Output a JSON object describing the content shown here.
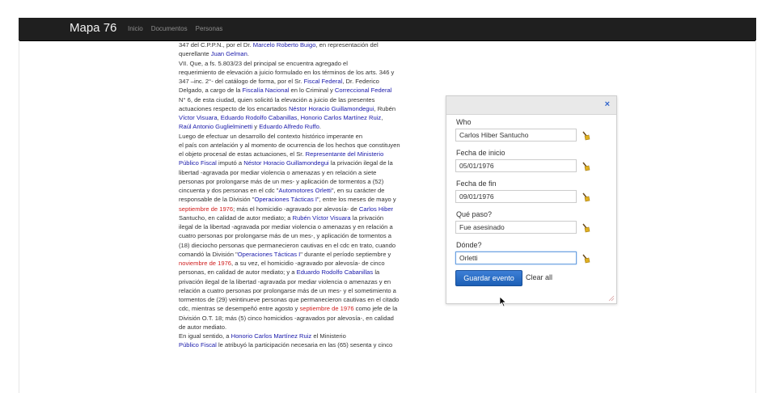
{
  "header": {
    "brand": "Mapa 76",
    "nav": [
      "Inicio",
      "Documentos",
      "Personas"
    ]
  },
  "article": {
    "lines": [
      [
        {
          "t": "347 del C.P.P.N., por el Dr. "
        },
        {
          "t": "Marcelo Roberto Buigo",
          "c": "lk"
        },
        {
          "t": ", en representación del"
        }
      ],
      [
        {
          "t": "querellante "
        },
        {
          "t": "Juan Gelman",
          "c": "lk"
        },
        {
          "t": "."
        }
      ],
      [
        {
          "t": "VII. Que, a fs. 5.803/23 del principal se encuentra agregado el"
        }
      ],
      [
        {
          "t": "requerimiento de elevación a juicio formulado en los términos de los arts. 346 y"
        }
      ],
      [
        {
          "t": "347 –inc. 2°- del catálogo de forma, por el Sr. "
        },
        {
          "t": "Fiscal Federal",
          "c": "lk"
        },
        {
          "t": ", Dr. Federico"
        }
      ],
      [
        {
          "t": "Delgado, a cargo de la "
        },
        {
          "t": "Fiscalía Nacional",
          "c": "lk"
        },
        {
          "t": " en lo Criminal y "
        },
        {
          "t": "Correccional Federal",
          "c": "lk"
        }
      ],
      [
        {
          "t": "N° 6, de esta ciudad, quien solicitó la elevación a juicio de las presentes"
        }
      ],
      [
        {
          "t": "actuaciones respecto de los encartados "
        },
        {
          "t": "Néstor Horacio Guillamondegui",
          "c": "lk"
        },
        {
          "t": ", Rubén"
        }
      ],
      [
        {
          "t": "Víctor Visuara",
          "c": "lk"
        },
        {
          "t": ", "
        },
        {
          "t": "Eduardo Rodolfo Cabanillas",
          "c": "lk"
        },
        {
          "t": ", "
        },
        {
          "t": "Honorio Carlos Martínez Ruiz",
          "c": "lk"
        },
        {
          "t": ","
        }
      ],
      [
        {
          "t": "Raúl Antonio Guglielminetti",
          "c": "lk"
        },
        {
          "t": " y "
        },
        {
          "t": "Eduardo Alfredo Ruffo",
          "c": "lk"
        },
        {
          "t": "."
        }
      ],
      [
        {
          "t": "Luego de efectuar un desarrollo del contexto histórico imperante en"
        }
      ],
      [
        {
          "t": "el país con antelación y al momento de ocurrencia de los hechos que constituyen"
        }
      ],
      [
        {
          "t": "el objeto procesal de estas actuaciones, el Sr. "
        },
        {
          "t": "Representante del Ministerio",
          "c": "lk"
        }
      ],
      [
        {
          "t": "Público Fiscal",
          "c": "lk"
        },
        {
          "t": " imputó a "
        },
        {
          "t": "Néstor Horacio Guillamondegui",
          "c": "lk"
        },
        {
          "t": " la privación ilegal de la"
        }
      ],
      [
        {
          "t": "libertad -agravada por mediar violencia o amenazas y en relación a siete"
        }
      ],
      [
        {
          "t": "personas por prolongarse más de un mes- y aplicación de tormentos a (52)"
        }
      ],
      [
        {
          "t": "cincuenta y dos personas en el cdc \""
        },
        {
          "t": "Automotores Orletti",
          "c": "lk"
        },
        {
          "t": "\", en su carácter de"
        }
      ],
      [
        {
          "t": "responsable de la División \""
        },
        {
          "t": "Operaciones Tácticas I",
          "c": "lk"
        },
        {
          "t": "\", entre los meses de mayo y"
        }
      ],
      [
        {
          "t": "septiembre de 1976",
          "c": "rd"
        },
        {
          "t": "; más el homicidio -agravado por alevosía- de "
        },
        {
          "t": "Carlos Hiber",
          "c": "lk"
        }
      ],
      [
        {
          "t": "Santucho, en calidad de autor mediato; a "
        },
        {
          "t": "Rubén Víctor Visuara",
          "c": "lk"
        },
        {
          "t": " la privación"
        }
      ],
      [
        {
          "t": "ilegal de la libertad -agravada por mediar violencia o amenazas y en relación a"
        }
      ],
      [
        {
          "t": "cuatro personas por prolongarse más de un mes-, y aplicación de tormentos a"
        }
      ],
      [
        {
          "t": "(18) dieciocho personas que permanecieron cautivas en el cdc en trato, cuando"
        }
      ],
      [
        {
          "t": "comandó la División \""
        },
        {
          "t": "Operaciones Tácticas I",
          "c": "lk"
        },
        {
          "t": "\" durante el período septiembre y"
        }
      ],
      [
        {
          "t": "noviembre de 1976",
          "c": "rd"
        },
        {
          "t": ", a su vez, el homicidio -agravado por alevosía- de cinco"
        }
      ],
      [
        {
          "t": "personas, en calidad de autor mediato; y a "
        },
        {
          "t": "Eduardo Rodolfo Cabanillas",
          "c": "lk"
        },
        {
          "t": " la"
        }
      ],
      [
        {
          "t": "privación ilegal de la libertad -agravada por mediar violencia o amenazas y en"
        }
      ],
      [
        {
          "t": "relación a cuatro personas por prolongarse más de un mes- y el sometimiento a"
        }
      ],
      [
        {
          "t": "tormentos de (29) veintinueve personas que permanecieron cautivas en el citado"
        }
      ],
      [
        {
          "t": "cdc, mientras se desempeñó entre agosto y "
        },
        {
          "t": "septiembre de 1976",
          "c": "rd"
        },
        {
          "t": " como jefe de la"
        }
      ],
      [
        {
          "t": "División O.T. 18; más (5) cinco homicidios -agravados por alevosía-, en calidad"
        }
      ],
      [
        {
          "t": "de autor mediato."
        }
      ],
      [
        {
          "t": "En igual sentido, a "
        },
        {
          "t": "Honorio Carlos Martínez Ruiz",
          "c": "lk"
        },
        {
          "t": " el Ministerio"
        }
      ],
      [
        {
          "t": "Público Fiscal",
          "c": "lk"
        },
        {
          "t": " le atribuyó la participación necesaria en las (65) sesenta y cinco"
        }
      ]
    ]
  },
  "dialog": {
    "close_label": "×",
    "fields": [
      {
        "label": "Who",
        "value": "Carlos Hiber Santucho"
      },
      {
        "label": "Fecha de inicio",
        "value": "05/01/1976"
      },
      {
        "label": "Fecha de fin",
        "value": "09/01/1976"
      },
      {
        "label": "Qué paso?",
        "value": "Fue asesinado"
      },
      {
        "label": "Dónde?",
        "value": "Orletti"
      }
    ],
    "save_label": "Guardar evento",
    "clear_label": "Clear all"
  },
  "icons": {
    "clear_field": "broom-icon",
    "resize": "resize-grip-icon",
    "cursor": "mouse-pointer-icon"
  },
  "colors": {
    "link": "#1a1aaa",
    "date_link": "#d02020",
    "navbar": "#1f1f1f",
    "primary_button": "#2a6fc9"
  }
}
